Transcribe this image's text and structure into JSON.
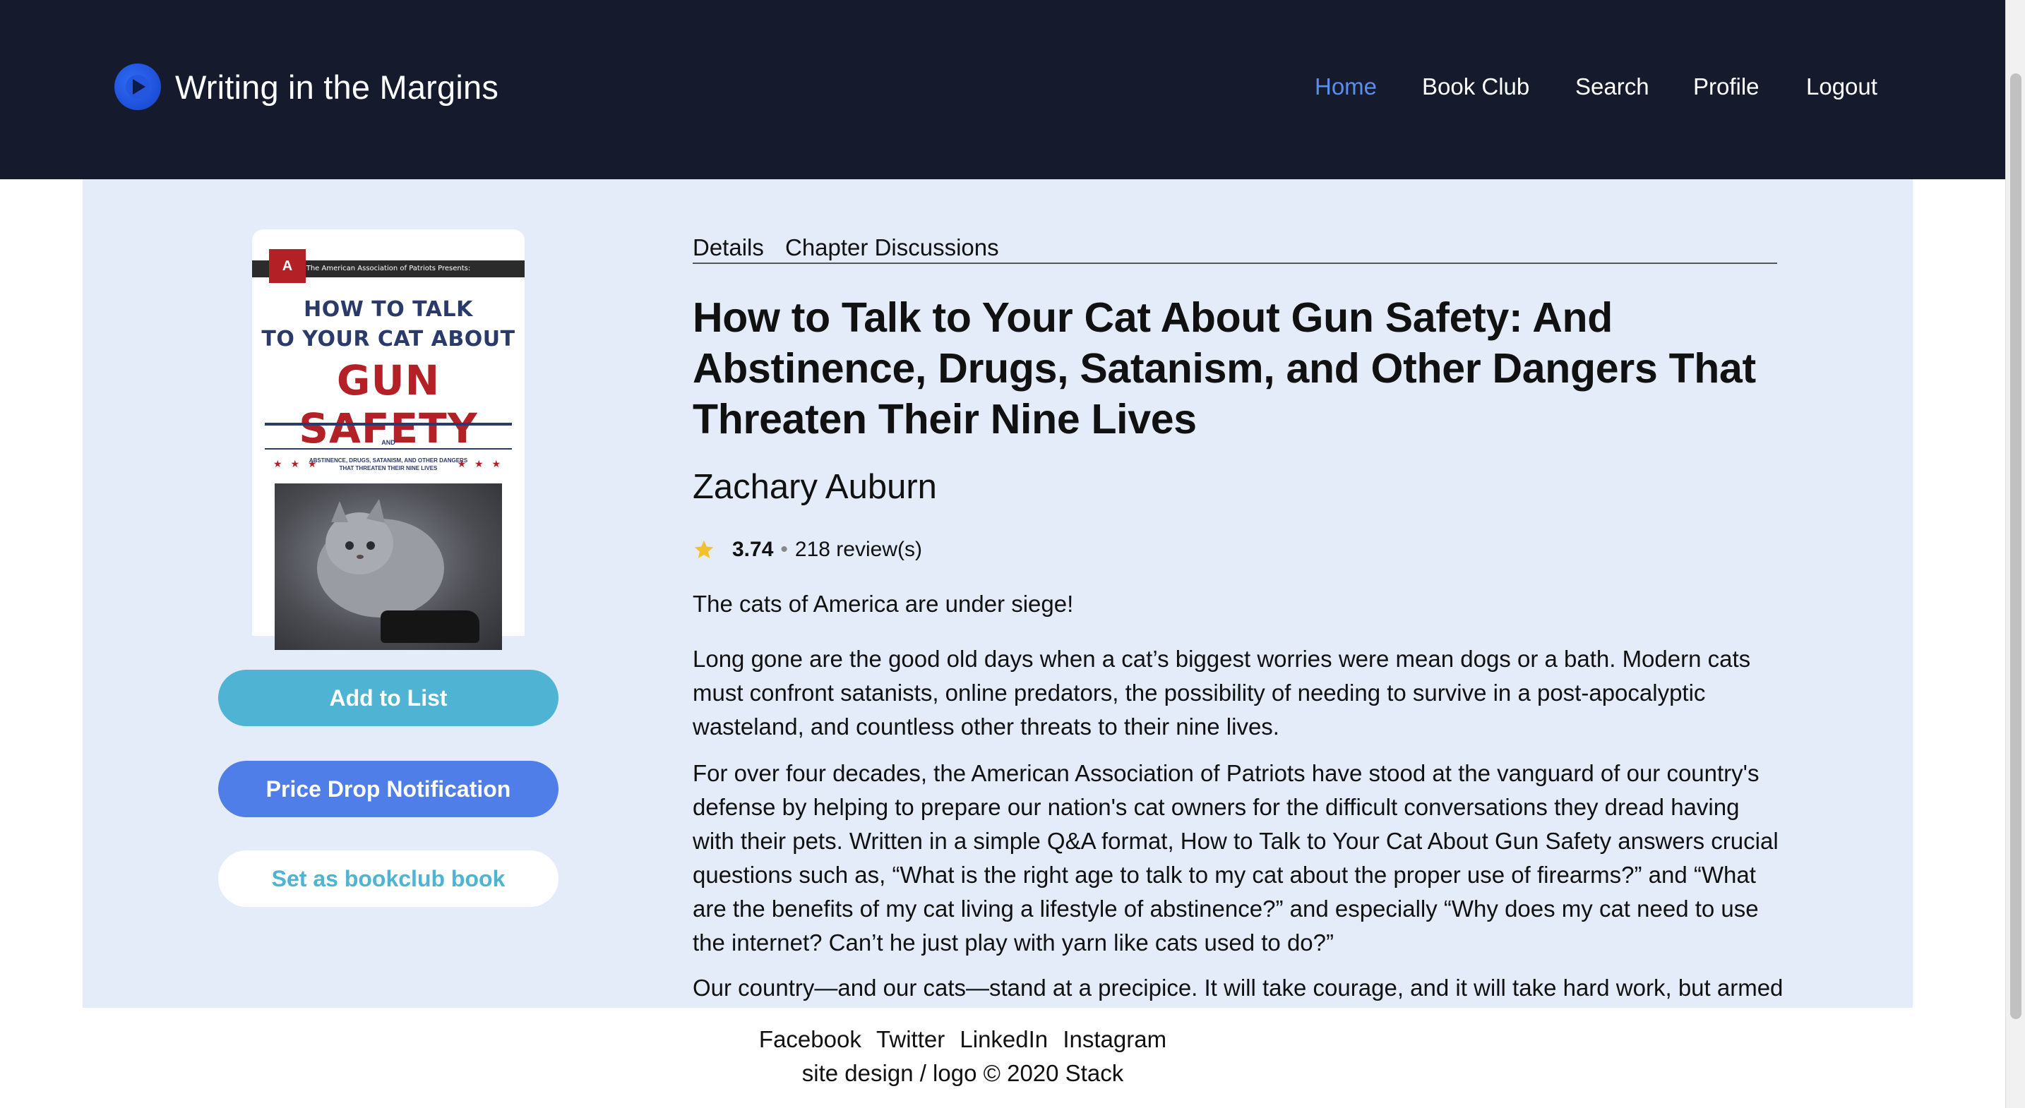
{
  "site": {
    "title": "Writing in the Margins",
    "logo_icon": "play-circle-icon"
  },
  "nav": {
    "items": [
      {
        "label": "Home",
        "active": true
      },
      {
        "label": "Book Club",
        "active": false
      },
      {
        "label": "Search",
        "active": false
      },
      {
        "label": "Profile",
        "active": false
      },
      {
        "label": "Logout",
        "active": false
      }
    ]
  },
  "cover": {
    "band_text": "The American Association of Patriots Presents:",
    "seal": "A",
    "line1": "HOW TO TALK",
    "line2": "TO YOUR CAT ABOUT",
    "big": "GUN SAFETY",
    "and": "AND",
    "subtitle": "ABSTINENCE, DRUGS, SATANISM, AND OTHER DANGERS THAT THREATEN THEIR NINE LIVES",
    "stars": "★ ★ ★"
  },
  "actions": {
    "add_to_list": "Add to List",
    "price_drop": "Price Drop Notification",
    "set_bookclub": "Set as bookclub book"
  },
  "tabs": [
    "Details",
    "Chapter Discussions"
  ],
  "book": {
    "title": "How to Talk to Your Cat About Gun Safety: And Abstinence, Drugs, Satanism, and Other Dangers That Threaten Their Nine Lives",
    "author": "Zachary Auburn",
    "rating": "3.74",
    "separator": "•",
    "reviews": "218 review(s)",
    "description": [
      "The cats of America are under siege!",
      "Long gone are the good old days when a cat’s biggest worries were mean dogs or a bath. Modern cats must confront satanists, online predators, the possibility of needing to survive in a post-apocalyptic wasteland, and countless other threats to their nine lives.",
      "For over four decades, the American Association of Patriots have stood at the vanguard of our country's defense by helping to prepare our nation's cat owners for the difficult conversations they dread having with their pets. Written in a simple Q&A format, How to Talk to Your Cat About Gun Safety answers crucial questions such as, “What is the right age to talk to my cat about the proper use of firearms?” and “What are the benefits of my cat living a lifestyle of abstinence?” and especially “Why does my cat need to use the internet? Can’t he just play with yarn like cats used to do?”",
      "Our country—and our cats—stand at a precipice. It will take courage, and it will take hard work, but armed"
    ]
  },
  "colors": {
    "navbar_bg": "#151b2c",
    "nav_active": "#5b8def",
    "panel_bg": "#e4ecfa",
    "btn_add": "#4fb3d3",
    "btn_price": "#4f7ee8",
    "star": "#f2c12e"
  },
  "footer": {
    "social": [
      "Facebook",
      "Twitter",
      "LinkedIn",
      "Instagram"
    ],
    "copyright": "site design / logo © 2020 Stack"
  }
}
